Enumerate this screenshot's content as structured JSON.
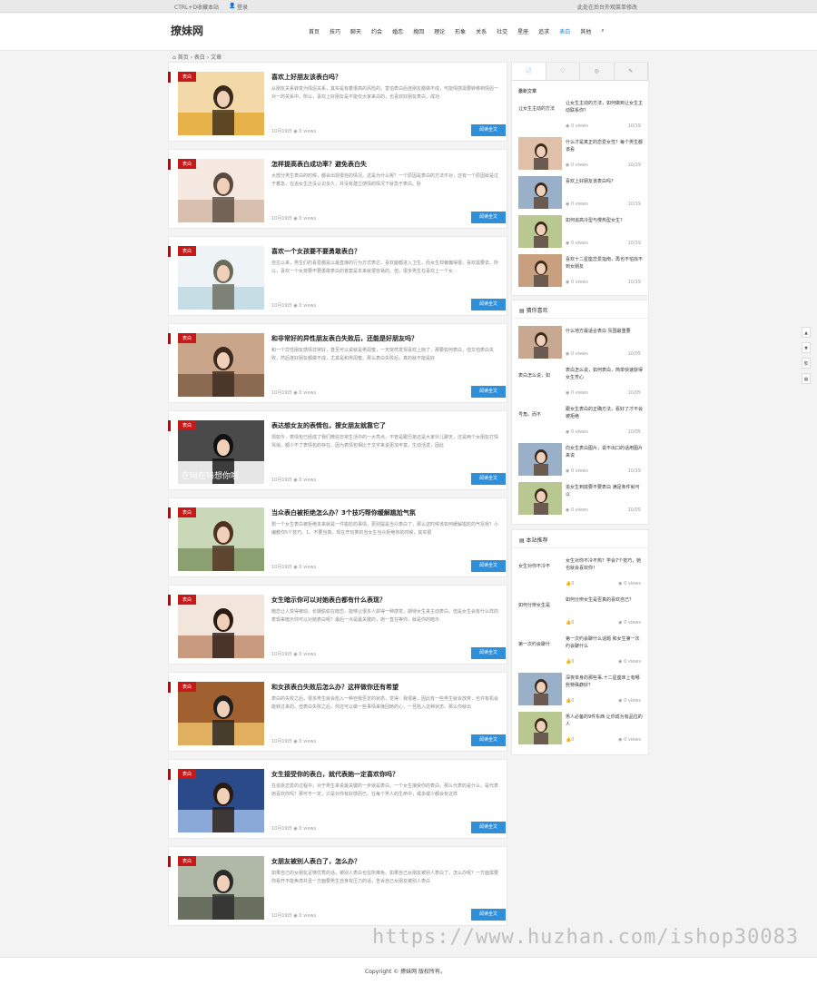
{
  "topbar": {
    "left": "CTRL+D收藏本站",
    "login": "登录",
    "right": "此处在后台外观菜单修改"
  },
  "site": {
    "logo": "撩妹网"
  },
  "nav": {
    "items": [
      "首页",
      "技巧",
      "聊天",
      "约会",
      "婚恋",
      "挽回",
      "理论",
      "形象",
      "关系",
      "社交",
      "星座",
      "追求",
      "表白",
      "其他"
    ],
    "active": "表白"
  },
  "breadcrumb": "首页 › 表白 › 文章",
  "posts": [
    {
      "tag": "表白",
      "title": "喜欢上好朋友该表白吗？",
      "excerpt": "从朋友关系转变为情侣关系，其实是有着很高的风险的。害怕表白后连朋友都做不成，可能情感需要转移到情侣一对一的关系中。所以，喜欢上好朋友是不能仅大家来白的，也喜欢好朋友表白，成功",
      "date": "10月19日",
      "views": "0 views",
      "btn": "阅读全文"
    },
    {
      "tag": "表白",
      "title": "怎样提高表白成功率？避免表白失",
      "excerpt": "大部分男生表白的时候，都会出现很自的情况。这是为什么呢？一个原因是表白的方法不对，还有一个原因就是过于着急，在追女生还没认识多久，并没有建立感情的情况下就急于表白。卧",
      "date": "10月19日",
      "views": "0 views",
      "btn": "阅读全文"
    },
    {
      "tag": "表白",
      "title": "喜欢一个女孩要不要勇敢表白？",
      "excerpt": "自古以来，男生们的喜爱都是以最直接的行为方式表达，喜欢腿都进入卫生，而女生却偏偏得很，喜欢需要去。所以，喜欢一个女孩要不要勇敢表白的答案是本来就很容易的。但，很多男生在喜欢上一个女",
      "date": "10月19日",
      "views": "0 views",
      "btn": "阅读全文"
    },
    {
      "tag": "表白",
      "title": "和非常好的异性朋友表白失败后，还能是好朋友吗？",
      "excerpt": "和一个异性朋友感情非常好，甚至可以说就是男闺蜜，一天突然发现喜欢上她了，那要如何表白，但又怕表白失败，然后连好朋友都做不成，尤其是和男闺蜜。那么表白失败后，真的就不能是好",
      "date": "10月19日",
      "views": "0 views",
      "btn": "阅读全文"
    },
    {
      "tag": "表白",
      "title": "表达想女友的表情包，撩女朋友就靠它了",
      "excerpt": "现如今，表情包已经成了我们微信日常生活中的一大亮点，不管是跟兄弟还是大家伙儿聊天，还是两个女朋友打情骂俏，都少不了表情包的存在。因为表情包相比于文字来说更加丰富，生动活泼，因此",
      "date": "10月19日",
      "views": "0 views",
      "btn": "阅读全文",
      "imgtext": "在吗在吗想你啦"
    },
    {
      "tag": "表白",
      "title": "当众表白被拒绝怎么办？3个技巧帮你缓解尴尬气氛",
      "excerpt": "想一个女生表白被拒绝本来就是一件尴尬的事情，更别提是当众表白了，那么这时候该如何缓解尴尬的气氛呢？小编教你5个技巧。1、不要当真，现在开玩笑的当女生当众拒绝你的时候，其实很",
      "date": "10月19日",
      "views": "0 views",
      "btn": "阅读全文"
    },
    {
      "tag": "表白",
      "title": "女生暗示你可以对她表白都有什么表现？",
      "excerpt": "暗恋让人变得被动，长期偷偷在暗恋，能够让很多人获得一种感觉，期待女生来主动表白。但是女生会有什么样的表现来暗示你可以对她表白呢？最后一点是最关键的，她一直在等你，就是你的暗示",
      "date": "10月19日",
      "views": "0 views",
      "btn": "阅读全文"
    },
    {
      "tag": "表白",
      "title": "和女孩表白失败后怎么办？这样做你还有希望",
      "excerpt": "表白的失败之后，很多男生就会陷入一种自我否定的状态，觉得：我很差，因此有一些男生就会放弃，也许有机会能转过来的。但表白失败之后，你还可以做一些事情来挽回她的心，一旦陷入这种状态，那么你就出",
      "date": "10月19日",
      "views": "0 views",
      "btn": "阅读全文"
    },
    {
      "tag": "表白",
      "title": "女生接受你的表白，就代表她一定喜欢你吗？",
      "excerpt": "在追逐恋爱的过程中，对于男生来说最关键的一步就是表白，一个女生接受你的表白，那么代表的是什么，是代表她喜欢你吗？那可不一定，只是对你有好感而已。在每个男人的生命中，或多或少都会有这样",
      "date": "10月19日",
      "views": "0 views",
      "btn": "阅读全文"
    },
    {
      "tag": "表白",
      "title": "女朋友被别人表白了，怎么办？",
      "excerpt": "如果自己的女朋友足够优秀的话，被别人表白也在所难免。如果自己女朋友被别人表白了，怎么办呢？一方面需要你看开不能焦虑并且一方面要男生自身有压力的话，告诉自己女朋友被别人表白",
      "date": "10月19日",
      "views": "0 views",
      "btn": "阅读全文"
    }
  ],
  "sidebar": {
    "tabs": [
      "📄",
      "♡",
      "◎",
      "✎"
    ],
    "recent_title": "最新文章",
    "recent": [
      {
        "thumbtext": "让女生主动的方法",
        "title": "让女生主动的方法，如何做到让女生主动联系你？",
        "views": "0 views",
        "date": "10/19"
      },
      {
        "thumbtext": "",
        "title": "什么才是真正的恋爱女性？每个男生都该看",
        "views": "0 views",
        "date": "10/19"
      },
      {
        "thumbtext": "",
        "title": "喜欢上好朋友该表白吗？",
        "views": "0 views",
        "date": "10/19"
      },
      {
        "thumbtext": "",
        "title": "如何追高冷型与慢热型女生？",
        "views": "0 views",
        "date": "10/19"
      },
      {
        "thumbtext": "",
        "title": "喜欢十二星座恋爱指南，再也不怕找不到女朋友",
        "views": "0 views",
        "date": "10/19"
      }
    ],
    "hot_title": "猜你喜欢",
    "hot": [
      {
        "thumbtext": "",
        "title": "什么地方最适合表白 氛围最重要",
        "views": "0 views",
        "date": "10/05"
      },
      {
        "thumbtext": "表白怎么说，如",
        "title": "表白怎么说，如何表白，简单快速获得女生芳心",
        "views": "0 views",
        "date": "10/05"
      },
      {
        "thumbtext": "号角。而不",
        "title": "跟女生表白的正确方法，看好了才不会被拒绝",
        "views": "0 views",
        "date": "10/05"
      },
      {
        "thumbtext": "",
        "title": "向女生表白图片，说不出口的话用图片来说",
        "views": "0 views",
        "date": "10/19"
      },
      {
        "thumbtext": "",
        "title": "追女生到底要不要表白 满足条件就可以",
        "views": "0 views",
        "date": "10/05"
      }
    ],
    "rec_title": "本站推荐",
    "rec": [
      {
        "thumbtext": "女生对你不冷不",
        "title": "女生对你不冷不热？学会7个技巧，她也就会喜欢你！",
        "likes": "0",
        "views": "0 views"
      },
      {
        "thumbtext": "如何分辨女生是",
        "title": "如何分辨女生是否真的喜欢自己？",
        "likes": "0",
        "views": "0 views"
      },
      {
        "thumbtext": "第一次约会聊什",
        "title": "第一次约会聊什么话题 和女生第一次约会聊什么",
        "likes": "0",
        "views": "0 views"
      },
      {
        "thumbtext": "",
        "title": "深夜单身的那些事,十二星座床上有哪些特殊癖好？",
        "likes": "0",
        "views": "0 views"
      },
      {
        "thumbtext": "",
        "title": "男人必备的9件东西 让你成为有品位的人",
        "likes": "0",
        "views": "0 views"
      }
    ]
  },
  "float": [
    "▲",
    "▼",
    "繁",
    "▦"
  ],
  "footer": "Copyright © 撩妹网 版权所有。",
  "watermark": "https://www.huzhan.com/ishop30083"
}
